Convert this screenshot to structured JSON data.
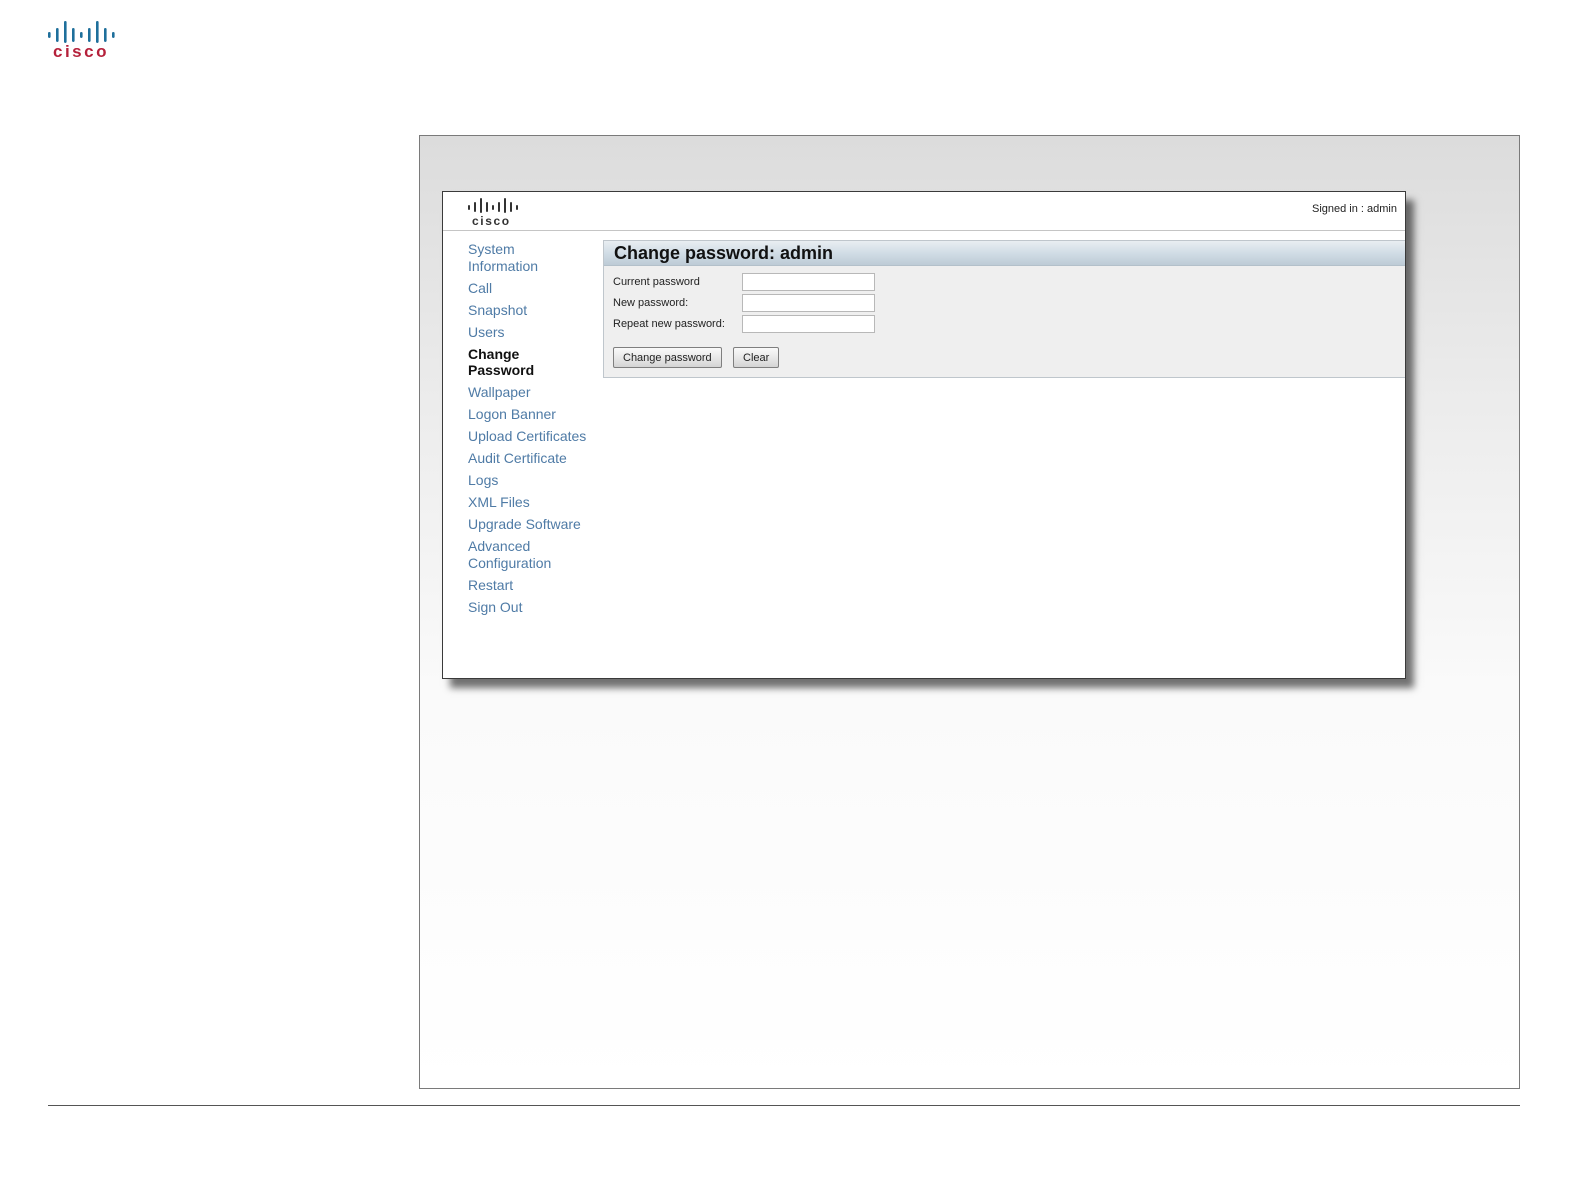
{
  "document": {
    "brand": "cisco"
  },
  "window": {
    "brand": "cisco",
    "signed_in_label": "Signed in : ",
    "signed_in_user": "admin"
  },
  "nav": {
    "items": [
      {
        "label": "System Information",
        "active": false
      },
      {
        "label": "Call",
        "active": false
      },
      {
        "label": "Snapshot",
        "active": false
      },
      {
        "label": "Users",
        "active": false
      },
      {
        "label": "Change Password",
        "active": true
      },
      {
        "label": "Wallpaper",
        "active": false
      },
      {
        "label": "Logon Banner",
        "active": false
      },
      {
        "label": "Upload Certificates",
        "active": false
      },
      {
        "label": "Audit Certificate",
        "active": false
      },
      {
        "label": "Logs",
        "active": false
      },
      {
        "label": "XML Files",
        "active": false
      },
      {
        "label": "Upgrade Software",
        "active": false
      },
      {
        "label": "Advanced Configuration",
        "active": false
      },
      {
        "label": "Restart",
        "active": false
      },
      {
        "label": "Sign Out",
        "active": false
      }
    ]
  },
  "form": {
    "title": "Change password: admin",
    "fields": {
      "current": {
        "label": "Current password",
        "value": ""
      },
      "new": {
        "label": "New password:",
        "value": ""
      },
      "repeat": {
        "label": "Repeat new password:",
        "value": ""
      }
    },
    "buttons": {
      "submit": "Change password",
      "clear": "Clear"
    }
  },
  "colors": {
    "link": "#4f7ba6",
    "logo_bars": "#1e6f9b",
    "logo_text": "#b5213b",
    "window_logo": "#333333"
  }
}
